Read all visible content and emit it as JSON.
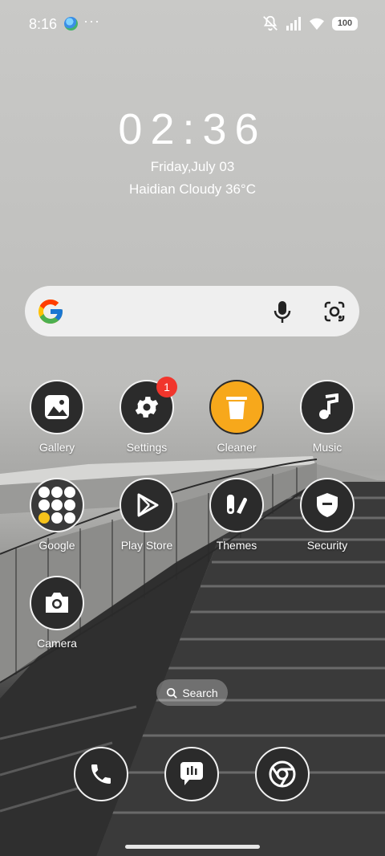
{
  "status": {
    "time": "8:16",
    "more": "···",
    "battery": "100"
  },
  "clock": {
    "time": "02:36",
    "date": "Friday,July 03",
    "weather": "Haidian Cloudy 36°C"
  },
  "search_widget": {
    "mic_icon": "mic-icon",
    "lens_icon": "lens-icon"
  },
  "apps": [
    {
      "label": "Gallery",
      "icon": "gallery-icon"
    },
    {
      "label": "Settings",
      "icon": "gear-icon",
      "badge": "1"
    },
    {
      "label": "Cleaner",
      "icon": "trash-icon"
    },
    {
      "label": "Music",
      "icon": "music-note-icon"
    },
    {
      "label": "Google",
      "icon": "folder-icon"
    },
    {
      "label": "Play Store",
      "icon": "play-icon"
    },
    {
      "label": "Themes",
      "icon": "themes-icon"
    },
    {
      "label": "Security",
      "icon": "shield-icon"
    },
    {
      "label": "Camera",
      "icon": "camera-icon"
    }
  ],
  "app_search": {
    "label": "Search"
  },
  "dock": [
    {
      "icon": "phone-icon"
    },
    {
      "icon": "messages-icon"
    },
    {
      "icon": "chrome-icon"
    }
  ],
  "colors": {
    "cleaner_yellow": "#f7a81b",
    "badge_red": "#f1352c"
  }
}
